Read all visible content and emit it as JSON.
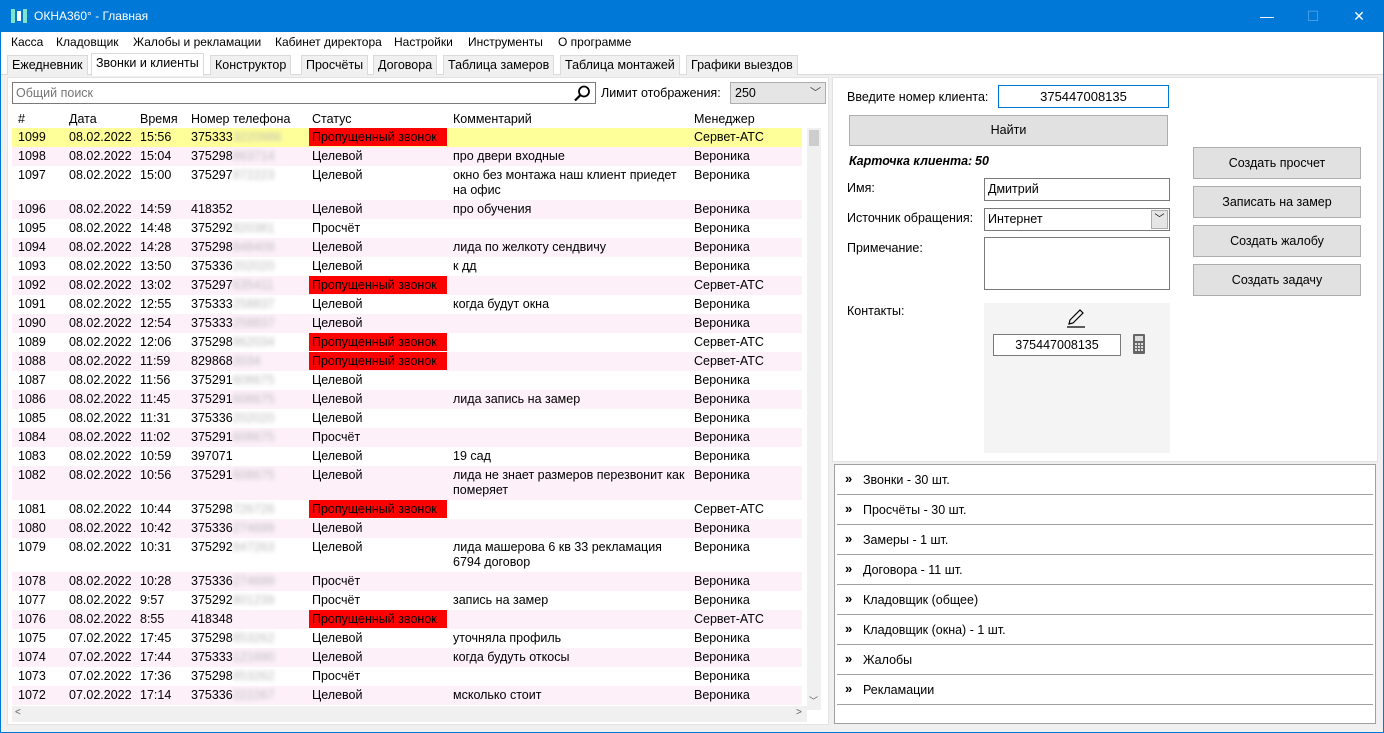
{
  "window": {
    "title": "ОКНА360° - Главная",
    "min": "—",
    "max": "☐",
    "close": "✕"
  },
  "menu": [
    "Касса",
    "Кладовщик",
    "Жалобы и рекламации",
    "Кабинет директора",
    "Настройки",
    "Инструменты",
    "О программе"
  ],
  "tabs": [
    "Ежедневник",
    "Звонки и клиенты",
    "Конструктор",
    "Просчёты",
    "Договора",
    "Таблица замеров",
    "Таблица монтажей",
    "Графики выездов"
  ],
  "search": {
    "placeholder": "Общий поиск"
  },
  "limit": {
    "label": "Лимит отображения:",
    "value": "250"
  },
  "grid": {
    "headers": [
      "#",
      "Дата",
      "Время",
      "Номер телефона",
      "Статус",
      "Комментарий",
      "Менеджер"
    ],
    "rows": [
      {
        "id": "1099",
        "date": "08.02.2022",
        "time": "15:56",
        "phone": "375333",
        "hidden": "3220986",
        "status": "Пропущенный звонок",
        "miss": true,
        "comment": "",
        "manager": "Сервет-АТС",
        "sel": true
      },
      {
        "id": "1098",
        "date": "08.02.2022",
        "time": "15:04",
        "phone": "375298",
        "hidden": "863714",
        "status": "Целевой",
        "comment": "про двери входные",
        "manager": "Вероника"
      },
      {
        "id": "1097",
        "date": "08.02.2022",
        "time": "15:00",
        "phone": "375297",
        "hidden": "872223",
        "status": "Целевой",
        "comment": "окно без монтажа наш клиент приедет на офис",
        "manager": "Вероника",
        "tall": true
      },
      {
        "id": "1096",
        "date": "08.02.2022",
        "time": "14:59",
        "phone": "418352",
        "hidden": "",
        "status": "Целевой",
        "comment": "про обучения",
        "manager": "Вероника"
      },
      {
        "id": "1095",
        "date": "08.02.2022",
        "time": "14:48",
        "phone": "375292",
        "hidden": "820381",
        "status": "Просчёт",
        "comment": "",
        "manager": "Вероника"
      },
      {
        "id": "1094",
        "date": "08.02.2022",
        "time": "14:28",
        "phone": "375298",
        "hidden": "848409",
        "status": "Целевой",
        "comment": "лида по желкоту сендвичу",
        "manager": "Вероника"
      },
      {
        "id": "1093",
        "date": "08.02.2022",
        "time": "13:50",
        "phone": "375336",
        "hidden": "202020",
        "status": "Целевой",
        "comment": "к дд",
        "manager": "Вероника"
      },
      {
        "id": "1092",
        "date": "08.02.2022",
        "time": "13:02",
        "phone": "375297",
        "hidden": "635411",
        "status": "Пропущенный звонок",
        "miss": true,
        "comment": "",
        "manager": "Сервет-АТС"
      },
      {
        "id": "1091",
        "date": "08.02.2022",
        "time": "12:55",
        "phone": "375333",
        "hidden": "258837",
        "status": "Целевой",
        "comment": " когда  будут окна",
        "manager": "Вероника"
      },
      {
        "id": "1090",
        "date": "08.02.2022",
        "time": "12:54",
        "phone": "375333",
        "hidden": "258837",
        "status": "Целевой",
        "comment": "",
        "manager": "Вероника"
      },
      {
        "id": "1089",
        "date": "08.02.2022",
        "time": "12:06",
        "phone": "375298",
        "hidden": "862034",
        "status": "Пропущенный звонок",
        "miss": true,
        "comment": "",
        "manager": "Сервет-АТС"
      },
      {
        "id": "1088",
        "date": "08.02.2022",
        "time": "11:59",
        "phone": "829868",
        "hidden": "2034",
        "status": "Пропущенный звонок",
        "miss": true,
        "comment": "",
        "manager": "Сервет-АТС"
      },
      {
        "id": "1087",
        "date": "08.02.2022",
        "time": "11:56",
        "phone": "375291",
        "hidden": "608675",
        "status": "Целевой",
        "comment": "",
        "manager": "Вероника"
      },
      {
        "id": "1086",
        "date": "08.02.2022",
        "time": "11:45",
        "phone": "375291",
        "hidden": "608675",
        "status": "Целевой",
        "comment": "лида запись на замер",
        "manager": "Вероника"
      },
      {
        "id": "1085",
        "date": "08.02.2022",
        "time": "11:31",
        "phone": "375336",
        "hidden": "202020",
        "status": "Целевой",
        "comment": "",
        "manager": "Вероника"
      },
      {
        "id": "1084",
        "date": "08.02.2022",
        "time": "11:02",
        "phone": "375291",
        "hidden": "608675",
        "status": "Просчёт",
        "comment": "",
        "manager": "Вероника"
      },
      {
        "id": "1083",
        "date": "08.02.2022",
        "time": "10:59",
        "phone": "397071",
        "hidden": "",
        "status": "Целевой",
        "comment": "19 сад",
        "manager": "Вероника"
      },
      {
        "id": "1082",
        "date": "08.02.2022",
        "time": "10:56",
        "phone": "375291",
        "hidden": "608675",
        "status": "Целевой",
        "comment": "лида не знает размеров перезвонит как померяет",
        "manager": "Вероника",
        "tall": true
      },
      {
        "id": "1081",
        "date": "08.02.2022",
        "time": "10:44",
        "phone": "375298",
        "hidden": "726726",
        "status": "Пропущенный звонок",
        "miss": true,
        "comment": "",
        "manager": "Сервет-АТС"
      },
      {
        "id": "1080",
        "date": "08.02.2022",
        "time": "10:42",
        "phone": "375336",
        "hidden": "274699",
        "status": "Целевой",
        "comment": "",
        "manager": "Вероника"
      },
      {
        "id": "1079",
        "date": "08.02.2022",
        "time": "10:31",
        "phone": "375292",
        "hidden": "847263",
        "status": "Целевой",
        "comment": "лида машерова 6 кв 33 рекламация 6794 договор",
        "manager": "Вероника",
        "tall": true
      },
      {
        "id": "1078",
        "date": "08.02.2022",
        "time": "10:28",
        "phone": "375336",
        "hidden": "274699",
        "status": "Просчёт",
        "comment": "",
        "manager": "Вероника"
      },
      {
        "id": "1077",
        "date": "08.02.2022",
        "time": "9:57",
        "phone": "375292",
        "hidden": "801239",
        "status": "Просчёт",
        "comment": "запись на замер",
        "manager": "Вероника"
      },
      {
        "id": "1076",
        "date": "08.02.2022",
        "time": "8:55",
        "phone": "418348",
        "hidden": "",
        "status": "Пропущенный звонок",
        "miss": true,
        "comment": "",
        "manager": "Сервет-АТС"
      },
      {
        "id": "1075",
        "date": "07.02.2022",
        "time": "17:45",
        "phone": "375298",
        "hidden": "853262",
        "status": "Целевой",
        "comment": "уточняла профиль",
        "manager": "Вероника"
      },
      {
        "id": "1074",
        "date": "07.02.2022",
        "time": "17:44",
        "phone": "375333",
        "hidden": "121690",
        "status": "Целевой",
        "comment": "когда будуть откосы",
        "manager": "Вероника"
      },
      {
        "id": "1073",
        "date": "07.02.2022",
        "time": "17:36",
        "phone": "375298",
        "hidden": "853262",
        "status": "Просчёт",
        "comment": "",
        "manager": "Вероника"
      },
      {
        "id": "1072",
        "date": "07.02.2022",
        "time": "17:14",
        "phone": "375336",
        "hidden": "222267",
        "status": "Целевой",
        "comment": "мсколько стоит",
        "manager": "Вероника"
      }
    ]
  },
  "client": {
    "prompt": "Введите номер клиента:",
    "number": "375447008135",
    "find": "Найти",
    "cardLabel": "Карточка клиента:",
    "cardNo": "50",
    "nameLabel": "Имя:",
    "name": "Дмитрий",
    "sourceLabel": "Источник обращения:",
    "source": "Интернет",
    "noteLabel": "Примечание:",
    "contactsLabel": "Контакты:",
    "contact": "375447008135"
  },
  "actions": [
    "Создать просчет",
    "Записать на замер",
    "Создать жалобу",
    "Создать задачу"
  ],
  "accordion": [
    "Звонки - 30 шт.",
    "Просчёты - 30 шт.",
    "Замеры - 1 шт.",
    "Договора - 11 шт.",
    "Кладовщик (общее)",
    "Кладовщик (окна) - 1 шт.",
    "Жалобы",
    "Рекламации"
  ]
}
